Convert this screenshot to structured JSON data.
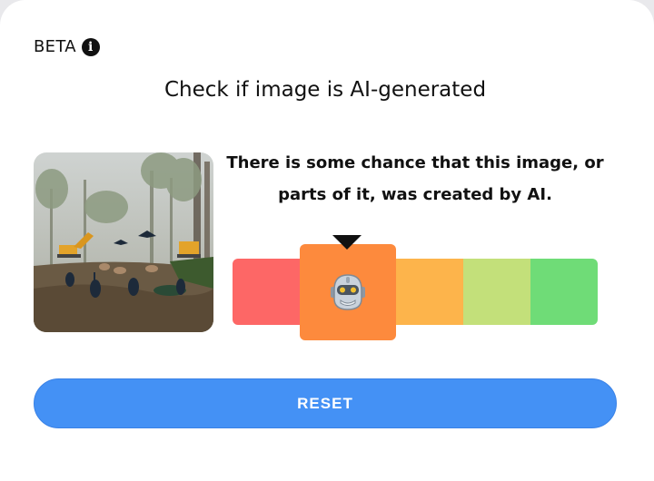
{
  "header": {
    "badge_label": "BETA",
    "info_icon": "info-icon",
    "title": "Check if image is AI-generated"
  },
  "result": {
    "message": "There is some chance that this image, or parts of it, was created by AI.",
    "scale": {
      "level": 2,
      "level_count": 5,
      "selected_icon": "robot-icon",
      "colors": [
        "#fd6766",
        "#fd8a3d",
        "#fdb44b",
        "#c3e07a",
        "#6fdc77"
      ]
    }
  },
  "thumbnail": {
    "description_icon": "uploaded-image-thumbnail"
  },
  "actions": {
    "reset_label": "RESET"
  },
  "colors": {
    "accent": "#4491f5",
    "background": "#ffffff"
  }
}
